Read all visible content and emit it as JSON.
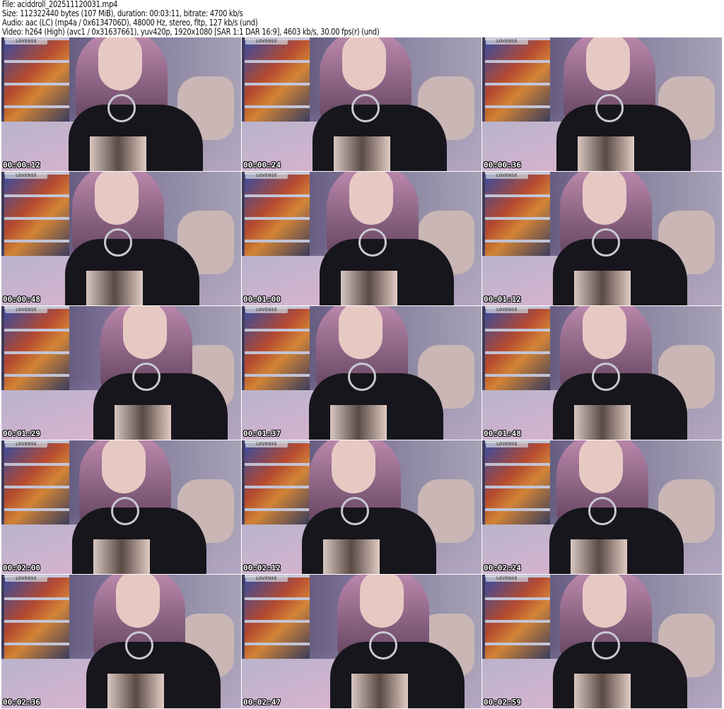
{
  "header": {
    "file": "File: aciddroll_202511120031.mp4",
    "size": "Size: 112322440 bytes (107 MiB), duration: 00:03:11, bitrate: 4700 kb/s",
    "audio": "Audio: aac (LC) (mp4a / 0x6134706D), 48000 Hz, stereo, fltp, 127 kb/s (und)",
    "video": "Video: h264 (High) (avc1 / 0x31637661), yuv420p, 1920x1080 [SAR 1:1 DAR 16:9], 4603 kb/s, 30.00 fps(r) (und)"
  },
  "overlay_badge": "LOVENSE",
  "thumbnails": [
    {
      "time": "00:00:12"
    },
    {
      "time": "00:00:24"
    },
    {
      "time": "00:00:36"
    },
    {
      "time": "00:00:48"
    },
    {
      "time": "00:01:00"
    },
    {
      "time": "00:01:12"
    },
    {
      "time": "00:01:29"
    },
    {
      "time": "00:01:37"
    },
    {
      "time": "00:01:48"
    },
    {
      "time": "00:02:00"
    },
    {
      "time": "00:02:12"
    },
    {
      "time": "00:02:24"
    },
    {
      "time": "00:02:36"
    },
    {
      "time": "00:02:47"
    },
    {
      "time": "00:02:59"
    }
  ]
}
